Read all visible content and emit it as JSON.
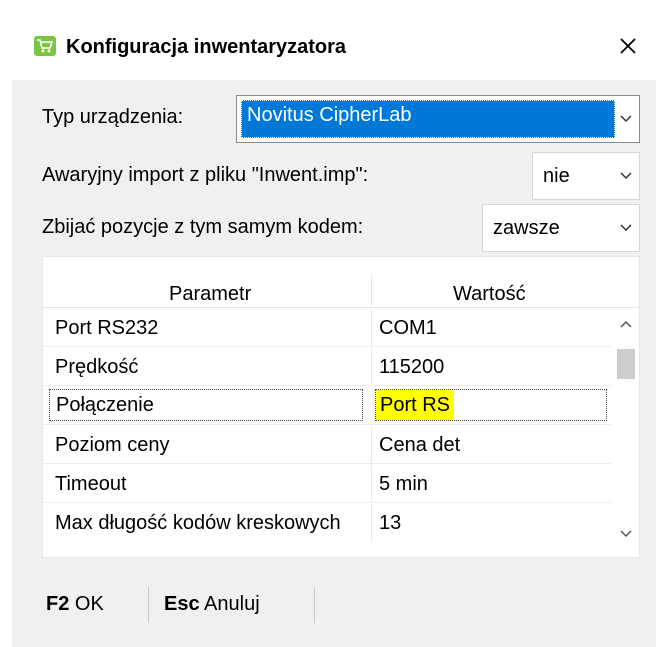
{
  "window": {
    "title": "Konfiguracja inwentaryzatora",
    "icon": "cart-icon",
    "accent_color": "#0078d7"
  },
  "form": {
    "device_type": {
      "label": "Typ urządzenia:",
      "value": "Novitus CipherLab"
    },
    "emergency_import": {
      "label": "Awaryjny import z pliku \"Inwent.imp\":",
      "value": "nie"
    },
    "merge_positions": {
      "label": "Zbijać pozycje z tym samym kodem:",
      "value": "zawsze"
    }
  },
  "grid": {
    "headers": [
      "Parametr",
      "Wartość"
    ],
    "rows": [
      {
        "param": "Port RS232",
        "value": "COM1"
      },
      {
        "param": "Prędkość",
        "value": "115200"
      },
      {
        "param": "Połączenie",
        "value": "Port RS",
        "focused": true,
        "highlight_color": "#ffff00"
      },
      {
        "param": "Poziom ceny",
        "value": "Cena det"
      },
      {
        "param": "Timeout",
        "value": "5 min"
      },
      {
        "param": "Max długość kodów kreskowych",
        "value": "13"
      }
    ]
  },
  "footer": {
    "ok": {
      "key": "F2",
      "label": "OK"
    },
    "cancel": {
      "key": "Esc",
      "label": "Anuluj"
    }
  }
}
